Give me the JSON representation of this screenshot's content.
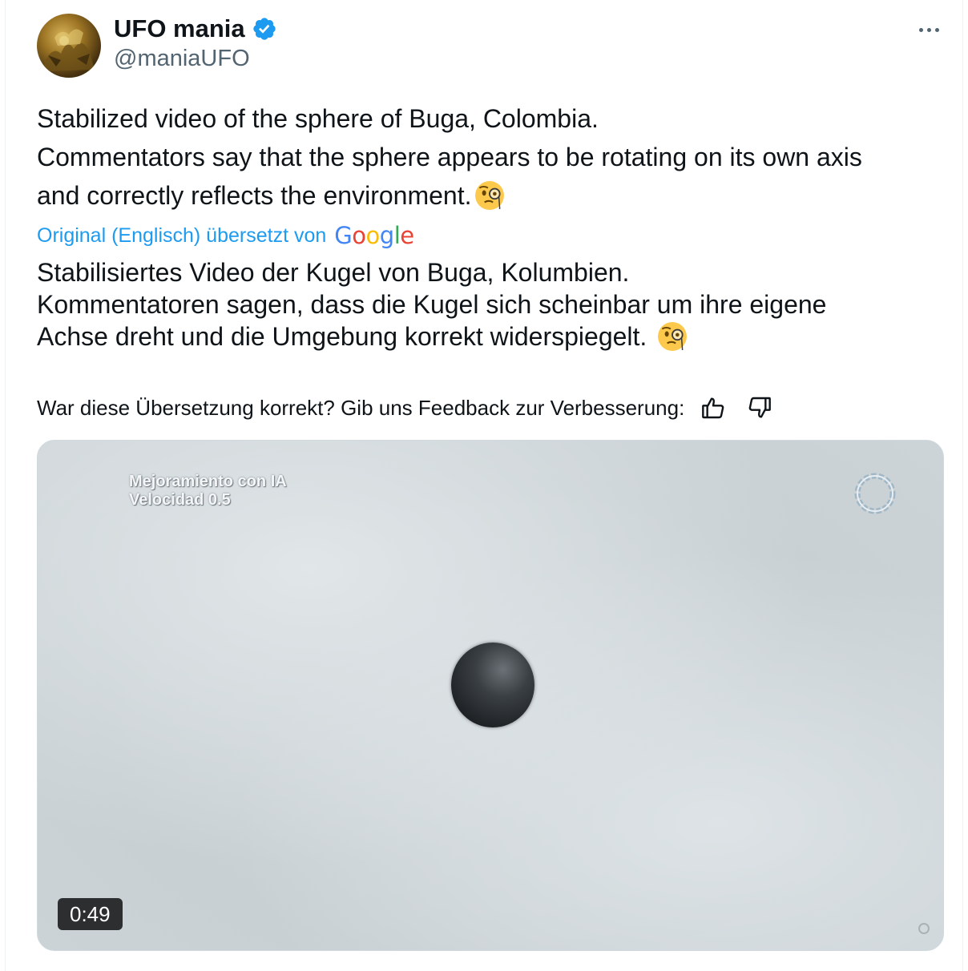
{
  "author": {
    "display_name": "UFO mania",
    "handle": "@maniaUFO",
    "verified": true,
    "avatar_icon": "golden-artwork-avatar"
  },
  "more_icon": "ellipsis-icon",
  "tweet": {
    "lines_en": [
      "Stabilized video of the sphere of Buga, Colombia.",
      "Commentators say that the sphere appears to be rotating on its own axis",
      "and correctly reflects the environment."
    ],
    "emoji": "face-with-monocle",
    "translated_label": "Original (Englisch) übersetzt von",
    "translator_logo": "Google",
    "lines_de": [
      "Stabilisiertes Video der Kugel von Buga, Kolumbien.",
      "Kommentatoren sagen, dass die Kugel sich scheinbar um ihre eigene",
      "Achse dreht und die Umgebung korrekt widerspiegelt."
    ],
    "feedback_prompt": "War diese Übersetzung korrekt? Gib uns Feedback zur Verbesserung:"
  },
  "video": {
    "overlay_line1": "Mejoramiento con IA",
    "overlay_line2": "Velocidad 0.5",
    "duration": "0:49",
    "channel_logo_icon": "ring-logo-icon"
  },
  "colors": {
    "text": "#0f1419",
    "secondary": "#536471",
    "link": "#1d9bf0",
    "verified": "#1d9bf0"
  }
}
